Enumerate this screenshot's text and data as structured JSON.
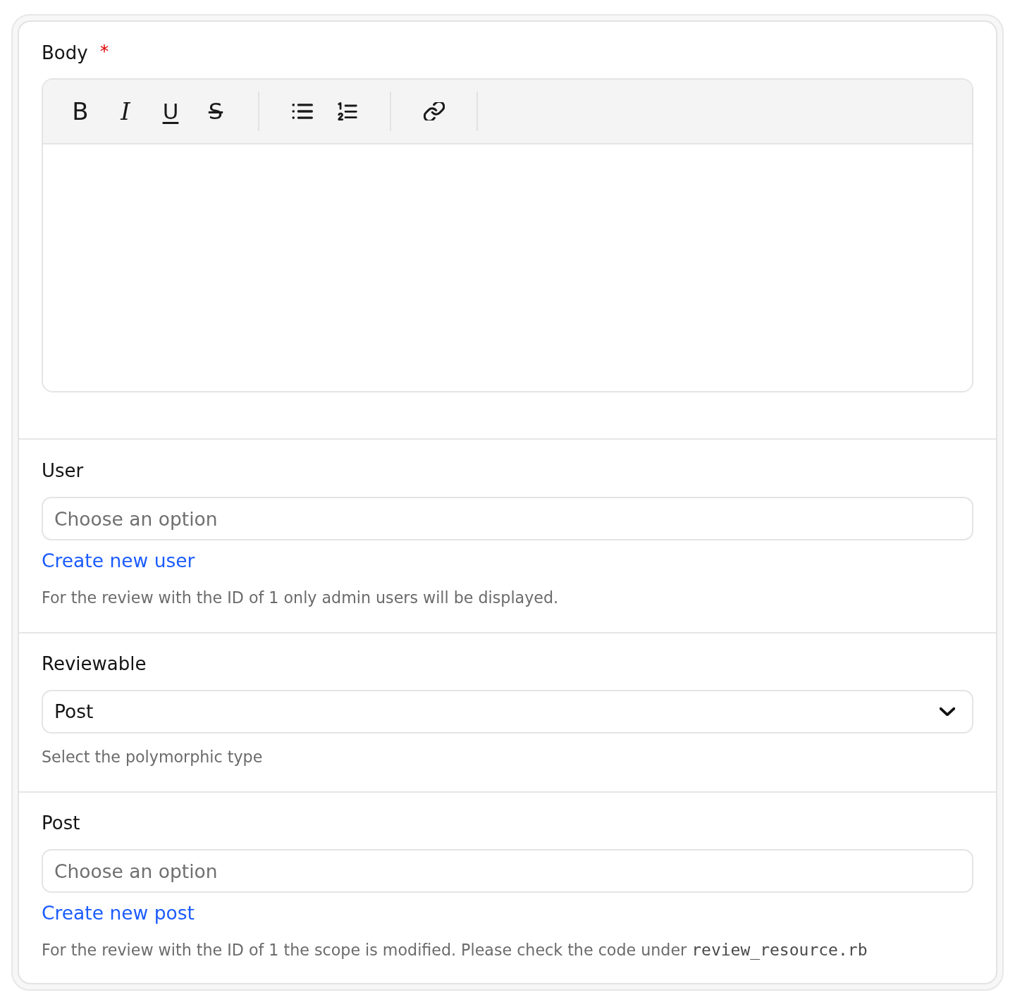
{
  "fields": [
    {
      "kind": "rich_text",
      "label": "Body",
      "required_mark": "*",
      "toolbar_groups": [
        {
          "buttons": [
            {
              "kind": "bold",
              "glyph": "B"
            },
            {
              "kind": "italic",
              "glyph": "I"
            },
            {
              "kind": "underline",
              "glyph": "U"
            },
            {
              "kind": "strike",
              "glyph": "S"
            }
          ]
        },
        {
          "buttons": [
            {
              "kind": "bullet_list"
            },
            {
              "kind": "numbered_list"
            }
          ]
        },
        {
          "buttons": [
            {
              "kind": "link"
            }
          ]
        }
      ]
    },
    {
      "kind": "search_select",
      "label": "User",
      "placeholder": "Choose an option",
      "link": "Create new user",
      "help": "For the review with the ID of 1 only admin users will be displayed."
    },
    {
      "kind": "select",
      "label": "Reviewable",
      "value": "Post",
      "help": "Select the polymorphic type"
    },
    {
      "kind": "search_select",
      "label": "Post",
      "placeholder": "Choose an option",
      "link": "Create new post",
      "help": "For the review with the ID of 1 the scope is modified. Please check the code under",
      "help_code": "review_resource.rb"
    }
  ]
}
